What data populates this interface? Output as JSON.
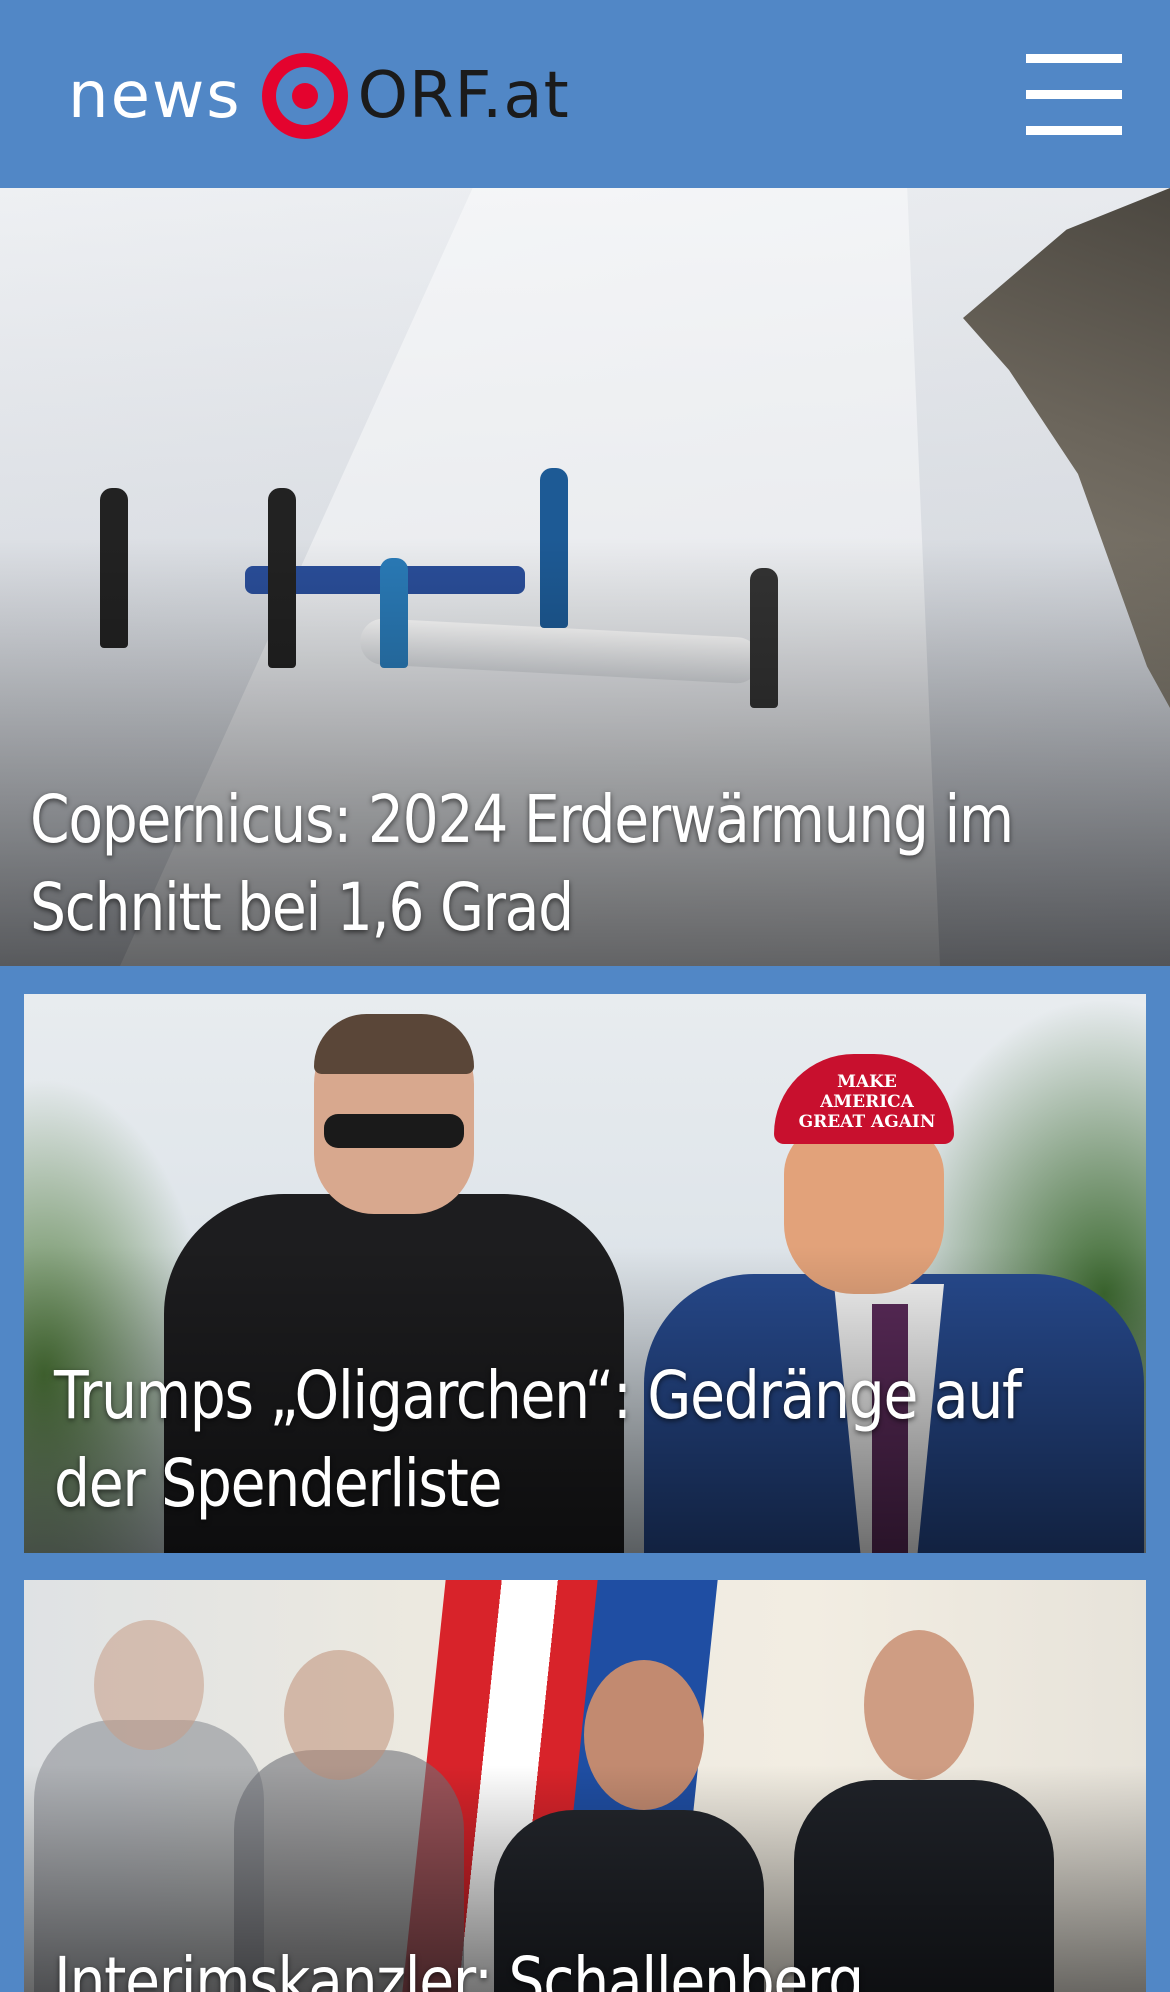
{
  "header": {
    "logo_news": "news",
    "logo_orf": "ORF.at",
    "menu_icon": "hamburger-menu-icon",
    "background_color": "#5187c6",
    "accent_color": "#e4032e"
  },
  "stories": [
    {
      "headline_line1": "Copernicus: 2024 Erderwärmung im",
      "headline_line2": "Schnitt bei 1,6 Grad"
    },
    {
      "headline_line1": "Trumps „Oligarchen“: Gedränge auf",
      "headline_line2": "der Spenderliste",
      "cap_text": "MAKE AMERICA GREAT AGAIN"
    },
    {
      "headline_line1": "Interimskanzler: Schallenberg"
    }
  ]
}
